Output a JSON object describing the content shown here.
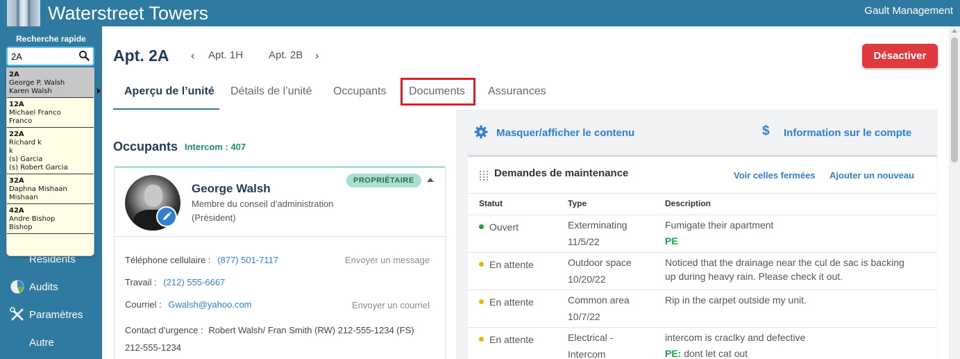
{
  "header": {
    "app_title": "Waterstreet Towers",
    "company": "Gault Management"
  },
  "sidebar": {
    "quick_search_label": "Recherche rapide",
    "search_value": "2A",
    "results": [
      {
        "apt": "2A",
        "lines": [
          "George P. Walsh",
          "Karen Walsh"
        ],
        "selected": true
      },
      {
        "apt": "12A",
        "lines": [
          "Michael Franco",
          "Franco"
        ],
        "selected": false
      },
      {
        "apt": "22A",
        "lines": [
          "Richard k",
          "k",
          "(s) Garcia",
          "(s) Robert Garcia"
        ],
        "selected": false
      },
      {
        "apt": "32A",
        "lines": [
          "Daphna Mishaan",
          "Mishaan"
        ],
        "selected": false
      },
      {
        "apt": "42A",
        "lines": [
          "Andre Bishop",
          "Bishop"
        ],
        "selected": false
      }
    ],
    "nav": [
      {
        "label": "Résidents",
        "icon": "residents-icon"
      },
      {
        "label": "Audits",
        "icon": "pie-chart-icon"
      },
      {
        "label": "Paramètres",
        "icon": "tools-icon"
      },
      {
        "label": "Autre",
        "icon": ""
      }
    ]
  },
  "unit": {
    "title": "Apt. 2A",
    "prev": "Apt. 1H",
    "next": "Apt. 2B",
    "deactivate": "Désactiver"
  },
  "tabs": [
    {
      "label": "Aperçu de l’unité",
      "active": true
    },
    {
      "label": "Détails de l’unité",
      "active": false
    },
    {
      "label": "Occupants",
      "active": false
    },
    {
      "label": "Documents",
      "active": false
    },
    {
      "label": "Assurances",
      "active": false
    }
  ],
  "occupants": {
    "title": "Occupants",
    "intercom": "Intercom : 407",
    "person": {
      "name": "George Walsh",
      "role": "Membre du conseil d’administration (Président)",
      "badge": "PROPRIÉTAIRE"
    },
    "cell_label": "Téléphone cellulaire :",
    "cell_value": "(877) 501-7117",
    "send_message": "Envoyer un message",
    "work_label": "Travail :",
    "work_value": "(212) 555-6667",
    "email_label": "Courriel :",
    "email_value": "Gwalsh@yahoo.com",
    "send_email": "Envoyer un courriel",
    "emergency_label": "Contact d’urgence :",
    "emergency_value": "Robert Walsh/ Fran Smith (RW) 212-555-1234 (FS)",
    "emergency_value2": "212-555-1234"
  },
  "right_panel": {
    "toggle_label": "Masquer/afficher le contenu",
    "account_label": "Information sur le compte",
    "maintenance": {
      "title": "Demandes de maintenance",
      "view_closed": "Voir celles fermées",
      "add_new": "Ajouter un nouveau",
      "headers": [
        "Statut",
        "Type",
        "Description"
      ],
      "rows": [
        {
          "status": "Ouvert",
          "status_color": "#18a34a",
          "type": [
            "Exterminating",
            "11/5/22"
          ],
          "desc": [
            "Fumigate their apartment"
          ],
          "pe": "PE",
          "pe_text": ""
        },
        {
          "status": "En attente",
          "status_color": "#f0b400",
          "type": [
            "Outdoor space",
            "10/20/22"
          ],
          "desc": [
            "Noticed that the drainage near the cul de sac is backing",
            "up during heavy rain. Please check it out."
          ],
          "pe": "",
          "pe_text": ""
        },
        {
          "status": "En attente",
          "status_color": "#f0b400",
          "type": [
            "Common area",
            "10/7/22"
          ],
          "desc": [
            "Rip in the carpet outside my unit."
          ],
          "pe": "",
          "pe_text": ""
        },
        {
          "status": "En attente",
          "status_color": "#f0b400",
          "type": [
            "Electrical -",
            "Intercom"
          ],
          "desc": [
            "intercom is craclky and defective"
          ],
          "pe": "PE:",
          "pe_text": " dont let cat out"
        }
      ]
    }
  }
}
